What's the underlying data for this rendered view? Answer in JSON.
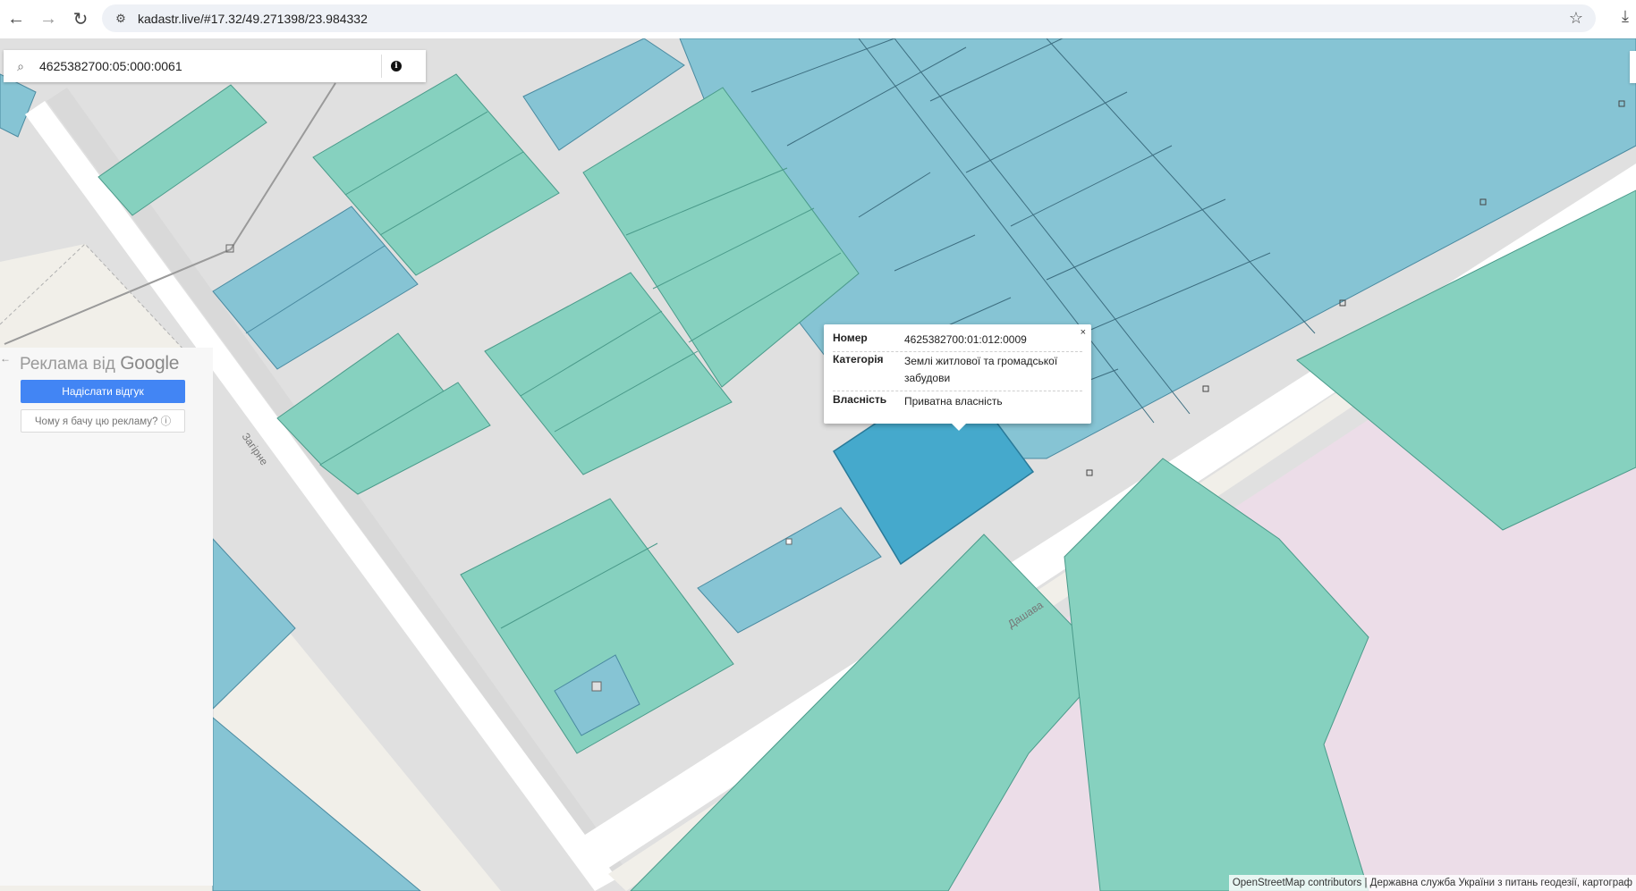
{
  "browser": {
    "url": "kadastr.live/#17.32/49.271398/23.984332",
    "back_icon": "←",
    "forward_icon": "→",
    "reload_icon": "↻",
    "site_info_icon": "⚙",
    "star_icon": "☆",
    "download_icon": "⤓"
  },
  "search": {
    "value": "4625382700:05:000:0061",
    "search_icon": "⌕",
    "info_icon": "i"
  },
  "ad": {
    "title_prefix": "Реклама від ",
    "title_brand": "Google",
    "feedback_button": "Надіслати відгук",
    "why_button": "Чому я бачу цю рекламу? ⓘ"
  },
  "popup": {
    "close": "×",
    "rows": [
      {
        "key": "Номер",
        "value": "4625382700:01:012:0009"
      },
      {
        "key": "Категорія",
        "value": "Землі житлової та громадської забудови"
      },
      {
        "key": "Власність",
        "value": "Приватна власність"
      }
    ]
  },
  "map": {
    "street_labels": [
      "Загірне",
      "Дашава"
    ],
    "colors": {
      "green_parcel": "#86d1bf",
      "blue_parcel": "#86c4d4",
      "selected_parcel": "#45a9cc",
      "residential_pink": "#ecdde8",
      "road": "#ffffff",
      "background": "#e0e0e0"
    }
  },
  "attribution": {
    "text": "OpenStreetMap contributors",
    "rest": " | Державна служба України з питань геодезії, картограф"
  }
}
